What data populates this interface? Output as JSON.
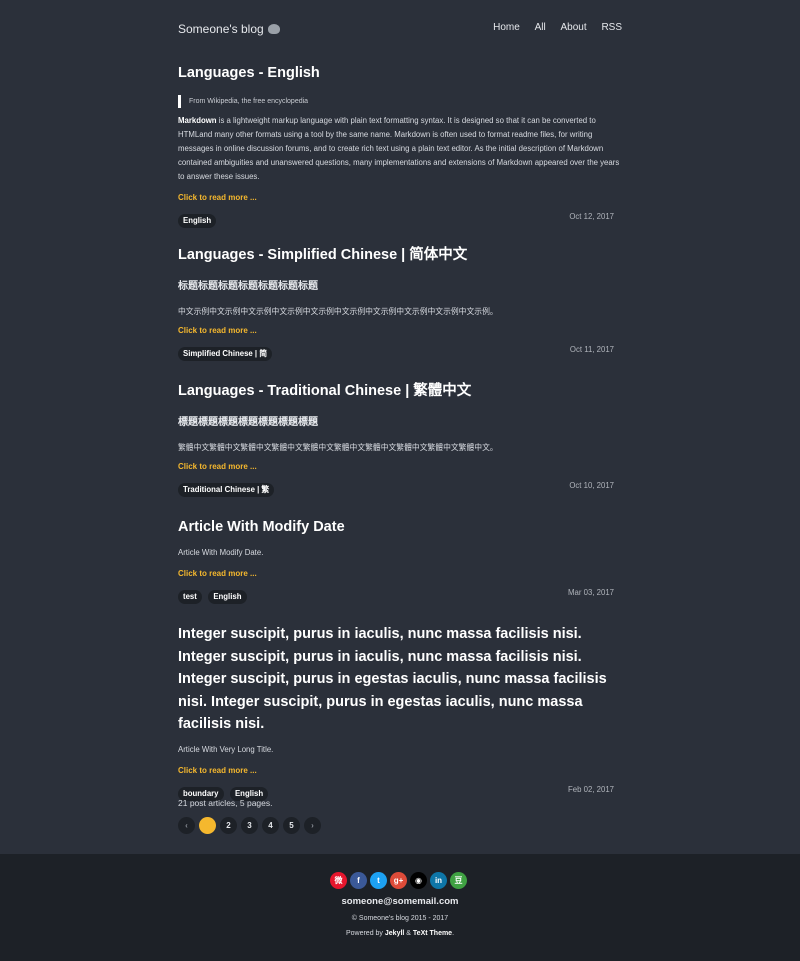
{
  "site": {
    "title": "Someone's blog",
    "emoji_icon": "elephant-icon"
  },
  "nav": [
    "Home",
    "All",
    "About",
    "RSS"
  ],
  "posts": [
    {
      "title": "Languages - English",
      "quote": "From Wikipedia, the free encyclopedia",
      "excerpt_bold": "Markdown",
      "excerpt": " is a lightweight markup language with plain text formatting syntax. It is designed so that it can be converted to HTMLand many other formats using a tool by the same name. Markdown is often used to format readme files, for writing messages in online discussion forums, and to create rich text using a plain text editor. As the initial description of Markdown contained ambiguities and unanswered questions, many implementations and extensions of Markdown appeared over the years to answer these issues.",
      "read_more": "Click to read more ...",
      "tags": [
        "English"
      ],
      "date": "Oct 12, 2017"
    },
    {
      "title": "Languages - Simplified Chinese | 简体中文",
      "subheading": "标题标题标题标题标题标题标题",
      "excerpt": "中文示例中文示例中文示例中文示例中文示例中文示例中文示例中文示例中文示例中文示例。",
      "read_more": "Click to read more ...",
      "tags": [
        "Simplified Chinese | 简"
      ],
      "date": "Oct 11, 2017"
    },
    {
      "title": "Languages - Traditional Chinese | 繁體中文",
      "subheading": "標題標題標題標題標題標題標題",
      "excerpt": "繁體中文繁體中文繁體中文繁體中文繁體中文繁體中文繁體中文繁體中文繁體中文繁體中文。",
      "read_more": "Click to read more ...",
      "tags": [
        "Traditional Chinese | 繁"
      ],
      "date": "Oct 10, 2017"
    },
    {
      "title": "Article With Modify Date",
      "excerpt": "Article With Modify Date.",
      "read_more": "Click to read more ...",
      "tags": [
        "test",
        "English"
      ],
      "date": "Mar 03, 2017"
    },
    {
      "title": "Integer suscipit, purus in iaculis, nunc massa facilisis nisi. Integer suscipit, purus in iaculis, nunc massa facilisis nisi. Integer suscipit, purus in egestas iaculis, nunc massa facilisis nisi. Integer suscipit, purus in egestas iaculis, nunc massa facilisis nisi.",
      "excerpt": "Article With Very Long Title.",
      "read_more": "Click to read more ...",
      "tags": [
        "boundary",
        "English"
      ],
      "date": "Feb 02, 2017"
    }
  ],
  "pagination": {
    "summary": "21 post articles, 5 pages.",
    "prev": "‹",
    "pages": [
      "1",
      "2",
      "3",
      "4",
      "5"
    ],
    "current": "1",
    "next": "›"
  },
  "footer": {
    "social": [
      {
        "name": "weibo-icon",
        "glyph": "微",
        "color": "#e6162d"
      },
      {
        "name": "facebook-icon",
        "glyph": "f",
        "color": "#3b5998"
      },
      {
        "name": "twitter-icon",
        "glyph": "t",
        "color": "#1da1f2"
      },
      {
        "name": "google-plus-icon",
        "glyph": "g+",
        "color": "#dd4b39"
      },
      {
        "name": "github-icon",
        "glyph": "◉",
        "color": "#000000"
      },
      {
        "name": "linkedin-icon",
        "glyph": "in",
        "color": "#0e76a8"
      },
      {
        "name": "douban-icon",
        "glyph": "豆",
        "color": "#3fa142"
      }
    ],
    "email": "someone@somemail.com",
    "copyright": "© Someone's blog 2015 - 2017",
    "powered_prefix": "Powered by ",
    "powered_jekyll": "Jekyll",
    "powered_amp": " & ",
    "powered_theme": "TeXt Theme",
    "powered_suffix": "."
  },
  "colors": {
    "background": "#2b303a",
    "footer": "#1d2127",
    "accent": "#f5b82e"
  }
}
